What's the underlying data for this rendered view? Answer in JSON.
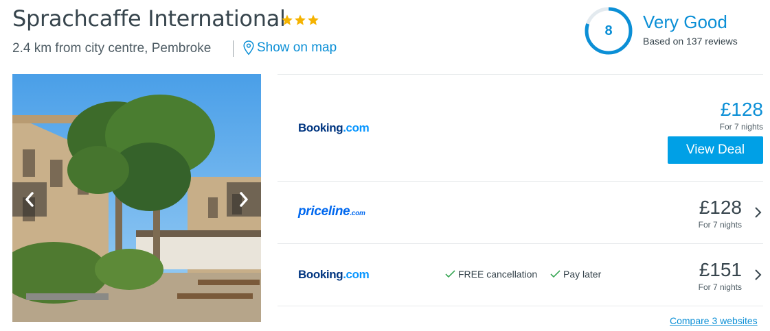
{
  "hotel": {
    "name": "Sprachcaffe International",
    "stars": 3,
    "location": "2.4 km from city centre, Pembroke",
    "show_map": "Show on map"
  },
  "rating": {
    "score": "8",
    "label": "Very Good",
    "reviews": "Based on 137 reviews",
    "score_fraction": 0.8
  },
  "colors": {
    "accent": "#0b8fd6",
    "button": "#00a0e6",
    "star": "#f5b301",
    "text": "#37454d"
  },
  "deals": [
    {
      "provider_main": "Booking",
      "provider_suffix": ".com",
      "price": "£128",
      "price_note": "For 7 nights",
      "cta": "View Deal"
    },
    {
      "provider_main": "priceline",
      "provider_suffix": ".com",
      "price": "£128",
      "price_note": "For 7 nights"
    },
    {
      "provider_main": "Booking",
      "provider_suffix": ".com",
      "perks": [
        "FREE cancellation",
        "Pay later"
      ],
      "price": "£151",
      "price_note": "For 7 nights"
    }
  ],
  "compare_link": "Compare 3 websites",
  "icons": {
    "star": "star-icon",
    "map": "map-pin-icon",
    "prev": "chevron-left-icon",
    "next": "chevron-right-icon",
    "check": "check-icon"
  }
}
